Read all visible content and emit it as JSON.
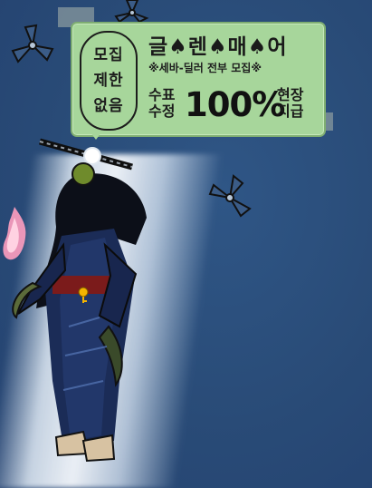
{
  "speech_bubble": {
    "left_lines": [
      "모집",
      "제한",
      "없음"
    ],
    "title": "글♠렌♠매♠어",
    "subtitle": "※세바-딜러 전부 모집※",
    "stack_left": [
      "수표",
      "수정"
    ],
    "big_text": "100%",
    "stack_right": [
      "현장",
      "지급"
    ]
  },
  "colors": {
    "bubble_fill": "#a7d69b",
    "bubble_border": "#7fae72",
    "background": "#2b4f7c"
  },
  "icons": [
    "shuriken-icon",
    "halo-icon",
    "flame-icon",
    "key-icon"
  ]
}
